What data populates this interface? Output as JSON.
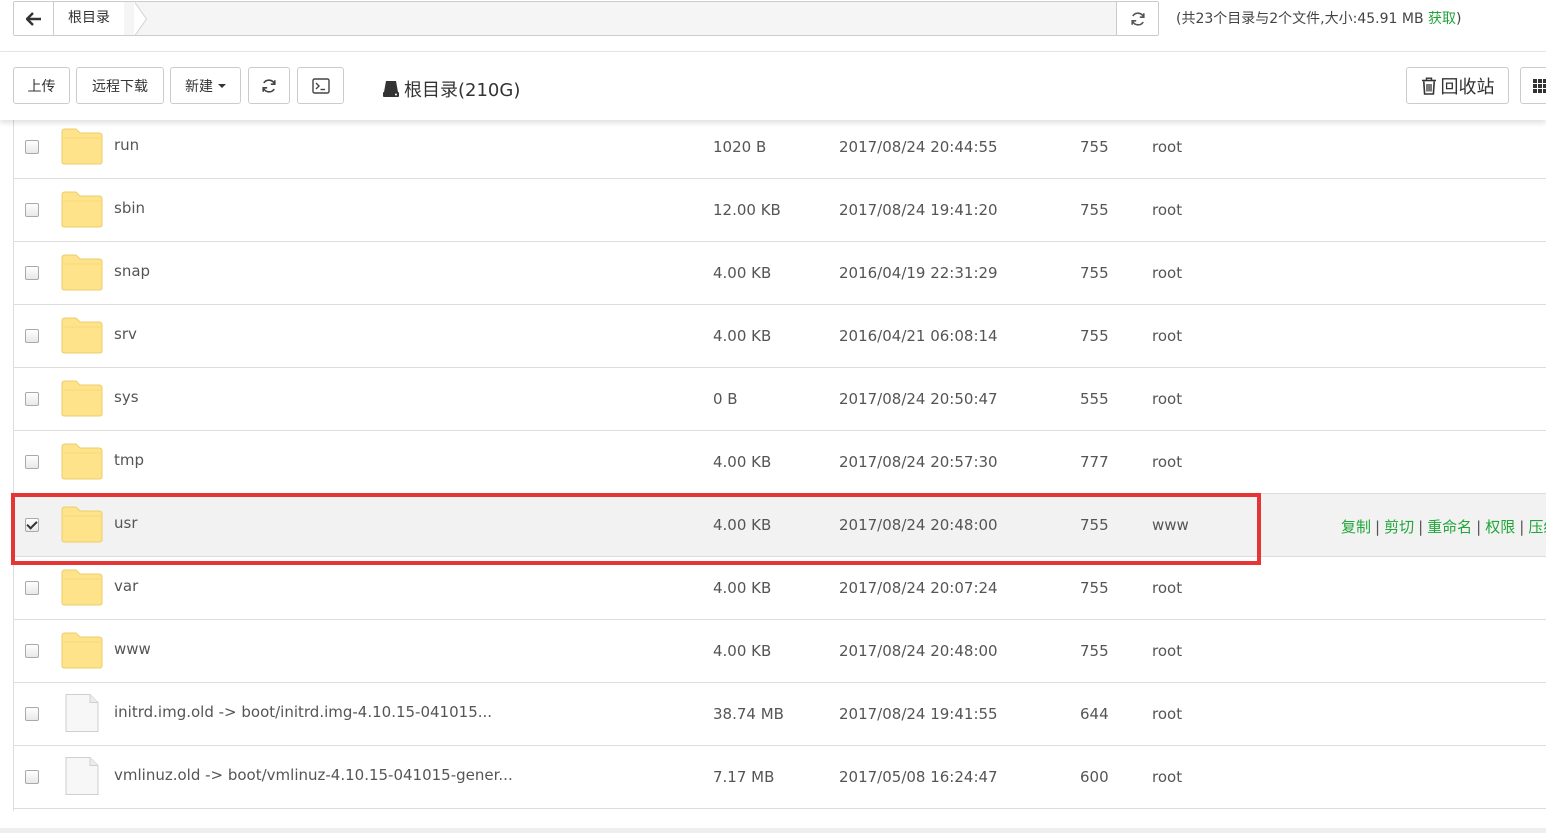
{
  "path_bar": {
    "crumb": "根目录",
    "summary": "(共23个目录与2个文件,大小:45.91 MB ",
    "summary_link": "获取",
    "summary_end": ")"
  },
  "toolbar": {
    "upload": "上传",
    "remote_download": "远程下载",
    "new": "新建",
    "disk": "根目录(210G)",
    "recycle_bin": "回收站"
  },
  "files": [
    {
      "name": "run",
      "size": "1020 B",
      "date": "2017/08/24 20:44:55",
      "perm": "755",
      "owner": "root",
      "type": "folder",
      "checked": false
    },
    {
      "name": "sbin",
      "size": "12.00 KB",
      "date": "2017/08/24 19:41:20",
      "perm": "755",
      "owner": "root",
      "type": "folder",
      "checked": false
    },
    {
      "name": "snap",
      "size": "4.00 KB",
      "date": "2016/04/19 22:31:29",
      "perm": "755",
      "owner": "root",
      "type": "folder",
      "checked": false
    },
    {
      "name": "srv",
      "size": "4.00 KB",
      "date": "2016/04/21 06:08:14",
      "perm": "755",
      "owner": "root",
      "type": "folder",
      "checked": false
    },
    {
      "name": "sys",
      "size": "0 B",
      "date": "2017/08/24 20:50:47",
      "perm": "555",
      "owner": "root",
      "type": "folder",
      "checked": false
    },
    {
      "name": "tmp",
      "size": "4.00 KB",
      "date": "2017/08/24 20:57:30",
      "perm": "777",
      "owner": "root",
      "type": "folder",
      "checked": false
    },
    {
      "name": "usr",
      "size": "4.00 KB",
      "date": "2017/08/24 20:48:00",
      "perm": "755",
      "owner": "www",
      "type": "folder",
      "checked": true
    },
    {
      "name": "var",
      "size": "4.00 KB",
      "date": "2017/08/24 20:07:24",
      "perm": "755",
      "owner": "root",
      "type": "folder",
      "checked": false
    },
    {
      "name": "www",
      "size": "4.00 KB",
      "date": "2017/08/24 20:48:00",
      "perm": "755",
      "owner": "root",
      "type": "folder",
      "checked": false
    },
    {
      "name": "initrd.img.old -> boot/initrd.img-4.10.15-041015...",
      "size": "38.74 MB",
      "date": "2017/08/24 19:41:55",
      "perm": "644",
      "owner": "root",
      "type": "file",
      "checked": false
    },
    {
      "name": "vmlinuz.old -> boot/vmlinuz-4.10.15-041015-gener...",
      "size": "7.17 MB",
      "date": "2017/05/08 16:24:47",
      "perm": "600",
      "owner": "root",
      "type": "file",
      "checked": false
    }
  ],
  "row_actions": [
    "复制",
    "剪切",
    "重命名",
    "权限",
    "压缩"
  ],
  "colors": {
    "accent_green": "#20a53a",
    "highlight_red": "#e63535",
    "folder_yellow": "#ffe38a"
  }
}
